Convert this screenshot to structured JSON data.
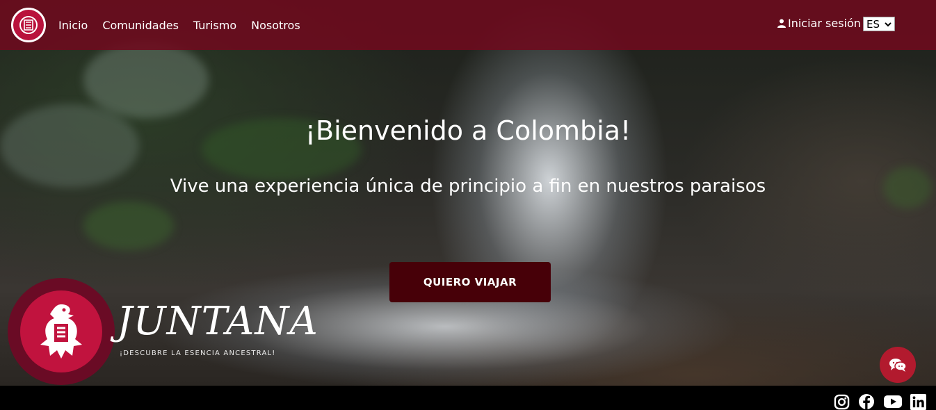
{
  "nav": {
    "links": [
      "Inicio",
      "Comunidades",
      "Turismo",
      "Nosotros"
    ],
    "login_label": "Iniciar sesión",
    "language": "ES"
  },
  "hero": {
    "title": "¡Bienvenido a Colombia!",
    "subtitle": "Vive una experiencia única de principio a fin en nuestros paraisos",
    "cta_label": "QUIERO VIAJAR"
  },
  "brand": {
    "name": "JUNTANA",
    "tagline": "¡DESCUBRE LA ESENCIA ANCESTRAL!"
  },
  "social": [
    "instagram-icon",
    "facebook-icon",
    "youtube-icon",
    "linkedin-icon"
  ],
  "colors": {
    "navbar": "#6e0a1e",
    "cta": "#470008",
    "brand": "#c1133e",
    "chat": "#b21a2e"
  }
}
